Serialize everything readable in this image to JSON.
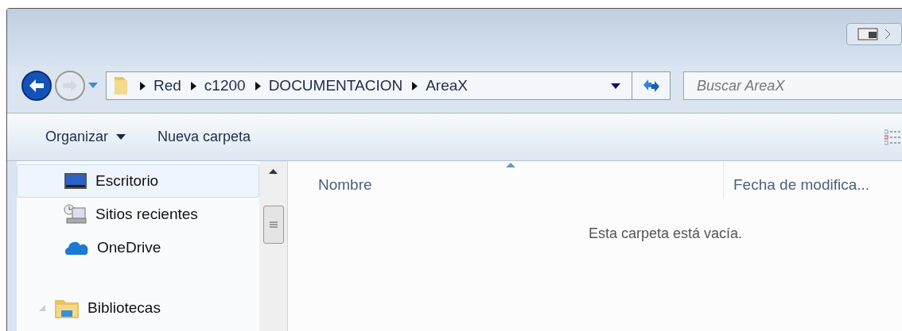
{
  "navigation": {
    "back": {
      "disabled": false
    },
    "forward": {
      "disabled": true
    }
  },
  "address_bar": {
    "path": [
      "Red",
      "c1200",
      "DOCUMENTACION",
      "AreaX"
    ]
  },
  "search": {
    "placeholder": "Buscar AreaX"
  },
  "toolbar": [
    {
      "kind": "menu",
      "label": "Organizar"
    },
    {
      "kind": "button",
      "label": "Nueva carpeta"
    }
  ],
  "sidebar": {
    "items": [
      {
        "kind": "desktop",
        "label": "Escritorio",
        "selected": true
      },
      {
        "kind": "recent",
        "label": "Sitios recientes",
        "selected": false
      },
      {
        "kind": "cloud",
        "label": "OneDrive",
        "selected": false
      },
      {
        "kind": "libraries",
        "label": "Bibliotecas",
        "selected": false,
        "expanded": true
      }
    ]
  },
  "table": {
    "columns": [
      {
        "label": "Nombre",
        "sorted": true
      },
      {
        "label": "Fecha de modifica...",
        "sorted": false
      }
    ],
    "empty_message": "Esta carpeta está vacía."
  }
}
